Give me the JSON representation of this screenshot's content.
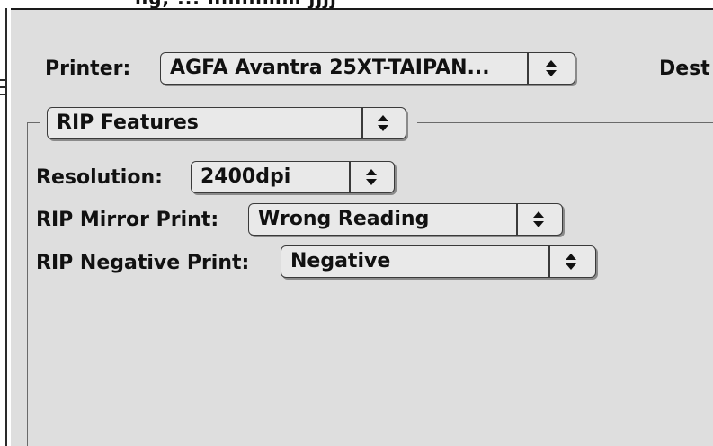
{
  "header": {
    "cropped_text": "ng,  ... nnnnmm  jjjj"
  },
  "printer": {
    "label": "Printer:",
    "selected": "AGFA Avantra 25XT-TAIPAN..."
  },
  "destination": {
    "label": "Dest"
  },
  "panel_menu": {
    "selected": "RIP Features"
  },
  "resolution": {
    "label": "Resolution:",
    "selected": "2400dpi"
  },
  "mirror_print": {
    "label": "RIP Mirror Print:",
    "selected": "Wrong Reading"
  },
  "negative_print": {
    "label": "RIP Negative Print:",
    "selected": "Negative"
  },
  "colors": {
    "panel_background": "#dedede",
    "popup_background": "#e9e9e9",
    "border": "#3a3a3a"
  },
  "icons": {
    "popup_arrows": "up-down-arrows-icon"
  }
}
